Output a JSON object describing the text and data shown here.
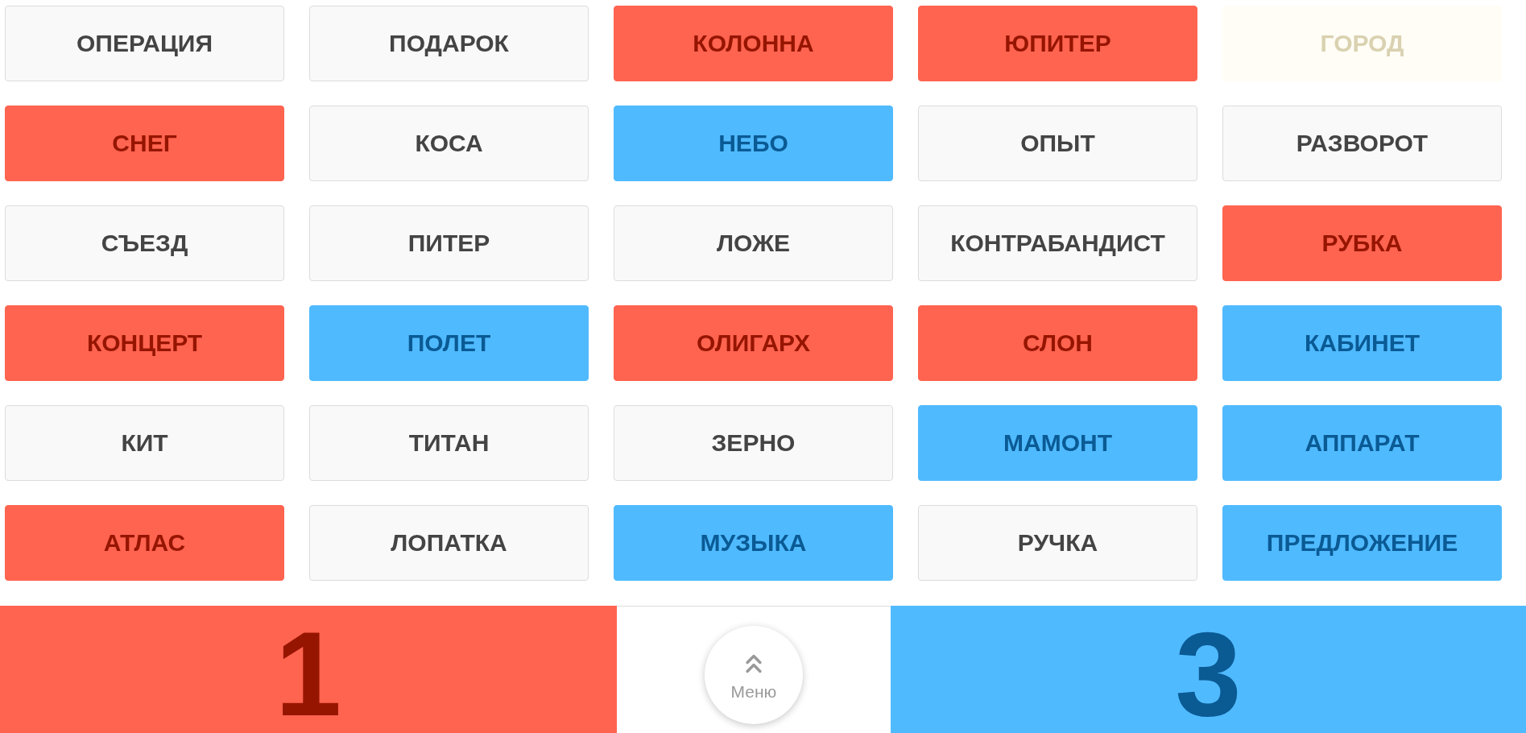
{
  "cards": [
    {
      "word": "ОПЕРАЦИЯ",
      "kind": "neutral"
    },
    {
      "word": "ПОДАРОК",
      "kind": "neutral"
    },
    {
      "word": "КОЛОННА",
      "kind": "red"
    },
    {
      "word": "ЮПИТЕР",
      "kind": "red"
    },
    {
      "word": "ГОРОД",
      "kind": "beige"
    },
    {
      "word": "СНЕГ",
      "kind": "red"
    },
    {
      "word": "КОСА",
      "kind": "neutral"
    },
    {
      "word": "НЕБО",
      "kind": "blue"
    },
    {
      "word": "ОПЫТ",
      "kind": "neutral"
    },
    {
      "word": "РАЗВОРОТ",
      "kind": "neutral"
    },
    {
      "word": "СЪЕЗД",
      "kind": "neutral"
    },
    {
      "word": "ПИТЕР",
      "kind": "neutral"
    },
    {
      "word": "ЛОЖЕ",
      "kind": "neutral"
    },
    {
      "word": "КОНТРАБАНДИСТ",
      "kind": "neutral"
    },
    {
      "word": "РУБКА",
      "kind": "red"
    },
    {
      "word": "КОНЦЕРТ",
      "kind": "red"
    },
    {
      "word": "ПОЛЕТ",
      "kind": "blue"
    },
    {
      "word": "ОЛИГАРХ",
      "kind": "red"
    },
    {
      "word": "СЛОН",
      "kind": "red"
    },
    {
      "word": "КАБИНЕТ",
      "kind": "blue"
    },
    {
      "word": "КИТ",
      "kind": "neutral"
    },
    {
      "word": "ТИТАН",
      "kind": "neutral"
    },
    {
      "word": "ЗЕРНО",
      "kind": "neutral"
    },
    {
      "word": "МАМОНТ",
      "kind": "blue"
    },
    {
      "word": "АППАРАТ",
      "kind": "blue"
    },
    {
      "word": "АТЛАС",
      "kind": "red"
    },
    {
      "word": "ЛОПАТКА",
      "kind": "neutral"
    },
    {
      "word": "МУЗЫКА",
      "kind": "blue"
    },
    {
      "word": "РУЧКА",
      "kind": "neutral"
    },
    {
      "word": "ПРЕДЛОЖЕНИЕ",
      "kind": "blue"
    }
  ],
  "score_bar": {
    "left_score": "1",
    "menu_button": {
      "label": "Меню"
    },
    "right_score": "3"
  }
}
